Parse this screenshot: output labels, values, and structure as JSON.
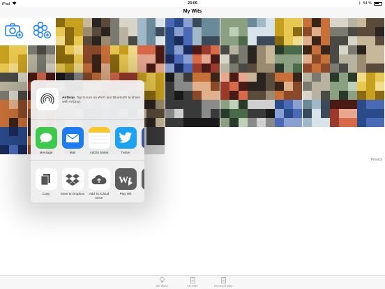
{
  "status_bar": {
    "device": "iPad",
    "time": "23:05",
    "battery": "54 %"
  },
  "nav": {
    "title": "My Wits"
  },
  "privacy_label": "Privacy",
  "share_sheet": {
    "airdrop": {
      "title": "AirDrop.",
      "description": "Tap to turn on Wi-Fi and Bluetooth to share with AirDrop."
    },
    "apps": [
      {
        "label": "Message",
        "icon": "messages-icon",
        "color": "#3dc94b"
      },
      {
        "label": "Mail",
        "icon": "mail-icon",
        "color": "#1e7cf2"
      },
      {
        "label": "Add to Notes",
        "icon": "notes-icon",
        "color": "#ffffff"
      },
      {
        "label": "Twitter",
        "icon": "twitter-icon",
        "color": "#1da1f2"
      }
    ],
    "actions": [
      {
        "label": "Copy",
        "icon": "copy-icon"
      },
      {
        "label": "Save to Dropbox",
        "icon": "dropbox-icon"
      },
      {
        "label": "Add To iCloud Drive",
        "icon": "icloud-drive-icon"
      },
      {
        "label": "Play Wit",
        "icon": "play-wit-icon"
      }
    ]
  },
  "tab_bar": {
    "items": [
      {
        "label": "Wit Ideas",
        "icon": "lightbulb-icon"
      },
      {
        "label": "My Wits",
        "icon": "document-icon"
      },
      {
        "label": "Received Wits",
        "icon": "received-document-icon"
      }
    ]
  },
  "actions": {
    "add_photo_icon": "camera-plus-icon",
    "add_collage_icon": "collage-plus-icon",
    "accent_color": "#1a82fb"
  }
}
